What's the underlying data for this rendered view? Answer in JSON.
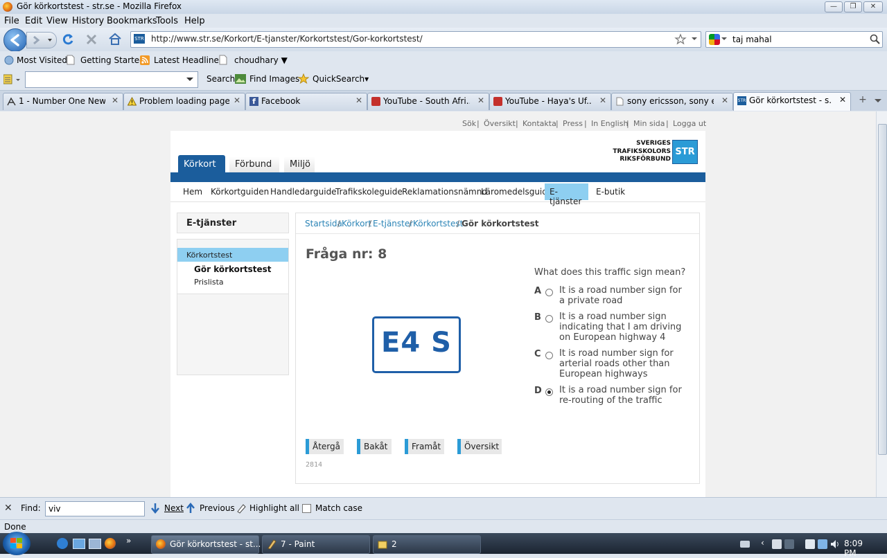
{
  "window": {
    "title": "Gör körkortstest - str.se - Mozilla Firefox"
  },
  "menubar": [
    "File",
    "Edit",
    "View",
    "History",
    "Bookmarks",
    "Tools",
    "Help"
  ],
  "navbar": {
    "url": "http://www.str.se/Korkort/E-tjanster/Korkortstest/Gor-korkortstest/",
    "search_value": "taj mahal"
  },
  "bookmarks": [
    "Most Visited",
    "Getting Started",
    "Latest Headlines",
    "choudhary ▼"
  ],
  "toolbar": {
    "search_label": "Search",
    "images_label": "Find Images",
    "quicksearch_label": "QuickSearch▾"
  },
  "tabs": [
    {
      "label": "1 - Number One New..."
    },
    {
      "label": "Problem loading page"
    },
    {
      "label": "Facebook"
    },
    {
      "label": "YouTube - South Afri..."
    },
    {
      "label": "YouTube - Haya's Uf..."
    },
    {
      "label": "sony ericsson, sony e..."
    },
    {
      "label": "Gör körkortstest - s..."
    }
  ],
  "site": {
    "util_links": [
      "Sök",
      "Översikt",
      "Kontakta",
      "Press",
      "In English",
      "Min sida",
      "Logga ut"
    ],
    "logo": {
      "line1": "SVERIGES",
      "line2": "TRAFIKSKOLORS",
      "line3": "RIKSFÖRBUND",
      "mark": "STR"
    },
    "main_tabs": [
      "Körkort",
      "Förbund",
      "Miljö"
    ],
    "subnav": [
      "Hem",
      "Körkortguiden",
      "Handledarguide",
      "Trafikskoleguide",
      "Reklamationsnämnd",
      "Läromedelsguide",
      "E-tjänster",
      "E-butik"
    ],
    "sidebar": {
      "title": "E-tjänster",
      "section": "Körkortstest",
      "items": [
        "Gör körkortstest",
        "Prislista"
      ]
    },
    "breadcrumb": [
      "Startsida",
      "Körkort",
      "E-tjänster",
      "Körkortstest"
    ],
    "breadcrumb_current": "Gör körkortstest",
    "breadcrumb_sep": "/"
  },
  "quiz": {
    "heading": "Fråga nr: 8",
    "sign_text": "E4 S",
    "question": "What does this traffic sign mean?",
    "options": [
      {
        "letter": "A",
        "lines": [
          "It is a road number sign for",
          "a private road"
        ],
        "selected": false
      },
      {
        "letter": "B",
        "lines": [
          "It is a road number sign",
          "indicating that I am driving",
          "on European highway 4"
        ],
        "selected": false
      },
      {
        "letter": "C",
        "lines": [
          "It is road number sign for",
          "arterial roads other than",
          "European highways"
        ],
        "selected": false
      },
      {
        "letter": "D",
        "lines": [
          "It is a road number sign for",
          "re-routing of the traffic"
        ],
        "selected": true
      }
    ],
    "buttons": [
      "Återgå",
      "Bakåt",
      "Framåt",
      "Översikt"
    ],
    "footer_code": "2814"
  },
  "findbar": {
    "label": "Find:",
    "value": "viv",
    "next": "Next",
    "previous": "Previous",
    "highlight": "Highlight all",
    "match_case": "Match case"
  },
  "status": {
    "text": "Done"
  },
  "taskbar": {
    "items": [
      "Gör körkortstest - st...",
      "7 - Paint",
      "2"
    ],
    "clock": "8:09 PM"
  },
  "colors": {
    "str_blue": "#1b5d9c",
    "accent_blue": "#2b9bd6",
    "active_subnav": "#8ecff1"
  }
}
